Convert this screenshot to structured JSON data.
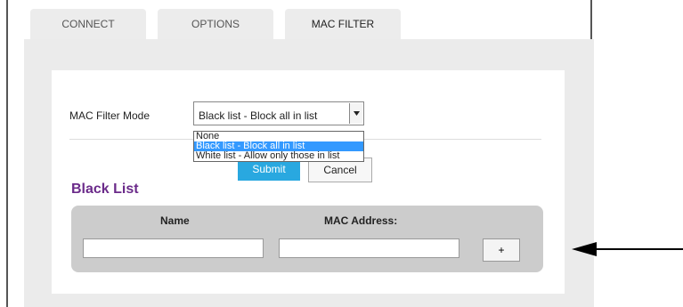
{
  "tabs": [
    {
      "label": "CONNECT"
    },
    {
      "label": "OPTIONS"
    },
    {
      "label": "MAC FILTER",
      "active": true
    }
  ],
  "mac_filter": {
    "mode_label": "MAC Filter Mode",
    "selected": "Black list - Block all in list",
    "options": [
      "None",
      "Black list - Block all in list",
      "White list - Allow only those in list"
    ],
    "submit_label": "Submit",
    "cancel_label": "Cancel"
  },
  "list": {
    "title": "Black List",
    "col_name": "Name",
    "col_mac": "MAC Address:",
    "add_label": "+"
  },
  "colors": {
    "accent": "#29a8e0",
    "title": "#6b2b8a",
    "highlight": "#3399ff"
  }
}
